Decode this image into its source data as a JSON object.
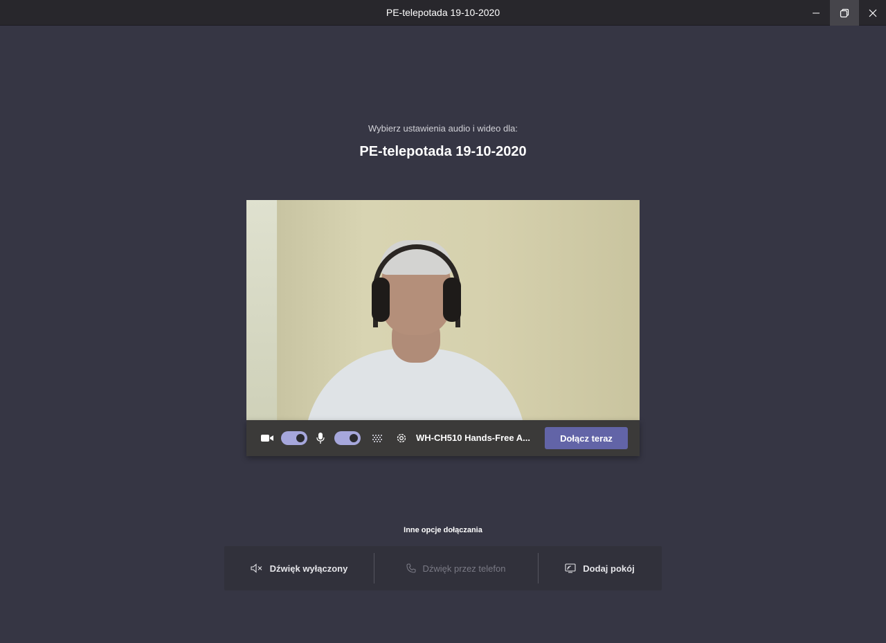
{
  "window": {
    "title": "PE-telepotada 19-10-2020",
    "controls": {
      "minimize": "minimize-icon",
      "restore": "restore-icon",
      "close": "close-icon"
    }
  },
  "prejoin": {
    "subtitle": "Wybierz ustawienia audio i wideo dla:",
    "meeting_title": "PE-telepotada 19-10-2020"
  },
  "controls": {
    "camera_on": true,
    "microphone_on": true,
    "device_label": "WH-CH510 Hands-Free A...",
    "join_label": "Dołącz teraz",
    "icons": [
      "camera-icon",
      "microphone-icon",
      "background-blur-icon",
      "gear-icon"
    ]
  },
  "other_options": {
    "label": "Inne opcje dołączania",
    "items": [
      {
        "label": "Dźwięk wyłączony",
        "icon": "speaker-muted-icon",
        "enabled": true
      },
      {
        "label": "Dźwięk przez telefon",
        "icon": "phone-icon",
        "enabled": false
      },
      {
        "label": "Dodaj pokój",
        "icon": "cast-room-icon",
        "enabled": true
      }
    ]
  },
  "colors": {
    "background": "#363644",
    "titlebar": "#28272c",
    "accent": "#6264a7",
    "toggle_on": "#a6a7dc"
  }
}
